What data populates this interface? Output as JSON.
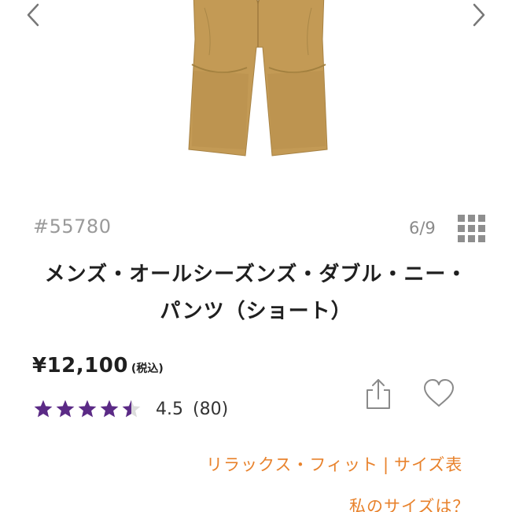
{
  "product": {
    "number": "#55780",
    "title_line1": "メンズ・オールシーズンズ・ダブル・ニー・",
    "title_line2": "パンツ（ショート）",
    "price": "¥12,100",
    "tax_note": "(税込)"
  },
  "carousel": {
    "counter": "6/9",
    "prev_icon": "chevron-left-icon",
    "next_icon": "chevron-right-icon",
    "image_color": "#c39a55"
  },
  "rating": {
    "value": "4.5",
    "count": "(80)",
    "stars": 4.5,
    "star_color": "#5b2a86"
  },
  "links": {
    "fit": "リラックス・フィット",
    "divider": "|",
    "size_chart": "サイズ表",
    "my_size": "私のサイズは？"
  },
  "colors": {
    "link": "#e8822c",
    "muted": "#9a9a9a"
  },
  "icons": {
    "grid": "grid-view-icon",
    "share": "share-icon",
    "favorite": "heart-icon"
  }
}
